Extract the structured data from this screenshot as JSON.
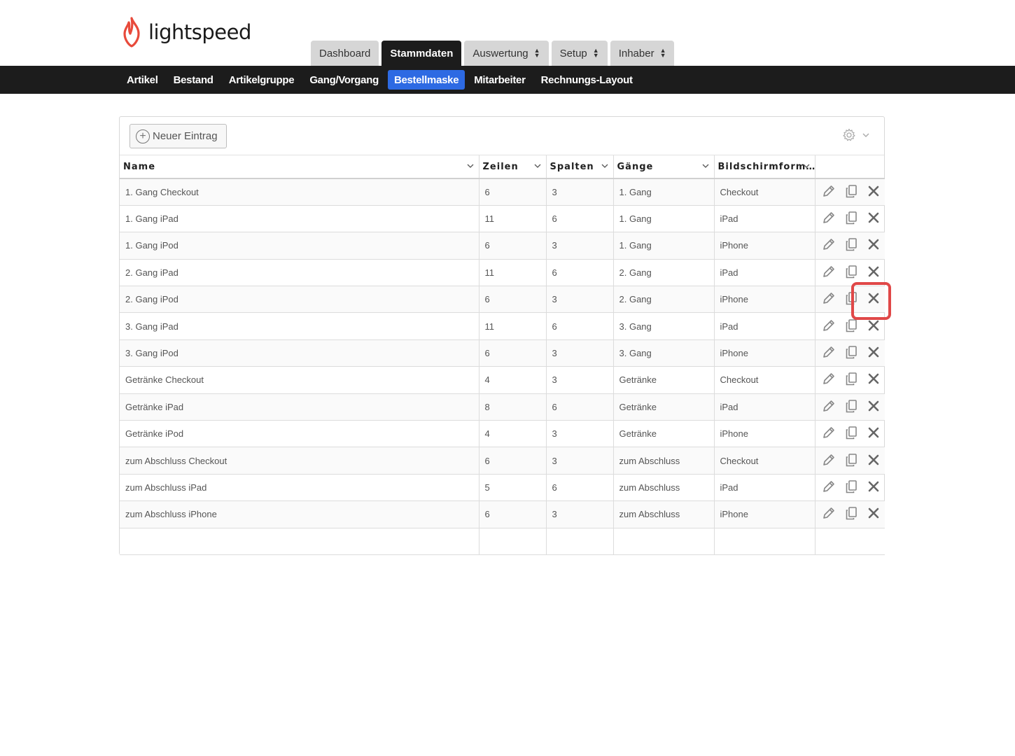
{
  "brand": {
    "name": "lightspeed",
    "color": "#e84a3b"
  },
  "top_tabs": [
    {
      "label": "Dashboard",
      "active": false,
      "dropdown": false
    },
    {
      "label": "Stammdaten",
      "active": true,
      "dropdown": false
    },
    {
      "label": "Auswertung",
      "active": false,
      "dropdown": true
    },
    {
      "label": "Setup",
      "active": false,
      "dropdown": true
    },
    {
      "label": "Inhaber",
      "active": false,
      "dropdown": true
    }
  ],
  "sub_nav": [
    {
      "label": "Artikel",
      "active": false
    },
    {
      "label": "Bestand",
      "active": false
    },
    {
      "label": "Artikelgruppe",
      "active": false
    },
    {
      "label": "Gang/Vorgang",
      "active": false
    },
    {
      "label": "Bestellmaske",
      "active": true
    },
    {
      "label": "Mitarbeiter",
      "active": false
    },
    {
      "label": "Rechnungs-Layout",
      "active": false
    }
  ],
  "toolbar": {
    "new_entry_label": "Neuer Eintrag",
    "settings_icon": "gear-icon"
  },
  "table": {
    "columns": [
      "Name",
      "Zeilen",
      "Spalten",
      "Gänge",
      "Bildschirmform…"
    ],
    "rows": [
      [
        "1. Gang Checkout",
        "6",
        "3",
        "1. Gang",
        "Checkout"
      ],
      [
        "1. Gang iPad",
        "11",
        "6",
        "1. Gang",
        "iPad"
      ],
      [
        "1. Gang iPod",
        "6",
        "3",
        "1. Gang",
        "iPhone"
      ],
      [
        "2. Gang iPad",
        "11",
        "6",
        "2. Gang",
        "iPad"
      ],
      [
        "2. Gang iPod",
        "6",
        "3",
        "2. Gang",
        "iPhone"
      ],
      [
        "3. Gang iPad",
        "11",
        "6",
        "3. Gang",
        "iPad"
      ],
      [
        "3. Gang iPod",
        "6",
        "3",
        "3. Gang",
        "iPhone"
      ],
      [
        "Getränke Checkout",
        "4",
        "3",
        "Getränke",
        "Checkout"
      ],
      [
        "Getränke iPad",
        "8",
        "6",
        "Getränke",
        "iPad"
      ],
      [
        "Getränke iPod",
        "4",
        "3",
        "Getränke",
        "iPhone"
      ],
      [
        "zum Abschluss Checkout",
        "6",
        "3",
        "zum Abschluss",
        "Checkout"
      ],
      [
        "zum Abschluss iPad",
        "5",
        "6",
        "zum Abschluss",
        "iPad"
      ],
      [
        "zum Abschluss iPhone",
        "6",
        "3",
        "zum Abschluss",
        "iPhone"
      ]
    ],
    "row_actions": [
      "pencil-icon",
      "copy-icon",
      "delete-icon"
    ]
  },
  "highlight": {
    "target": "delete-button",
    "row_index": 4,
    "color": "#e04848"
  },
  "colors": {
    "nav_bg": "#1c1c1c",
    "active_sub": "#2d6ae3",
    "tab_bg": "#d6d6d6"
  }
}
